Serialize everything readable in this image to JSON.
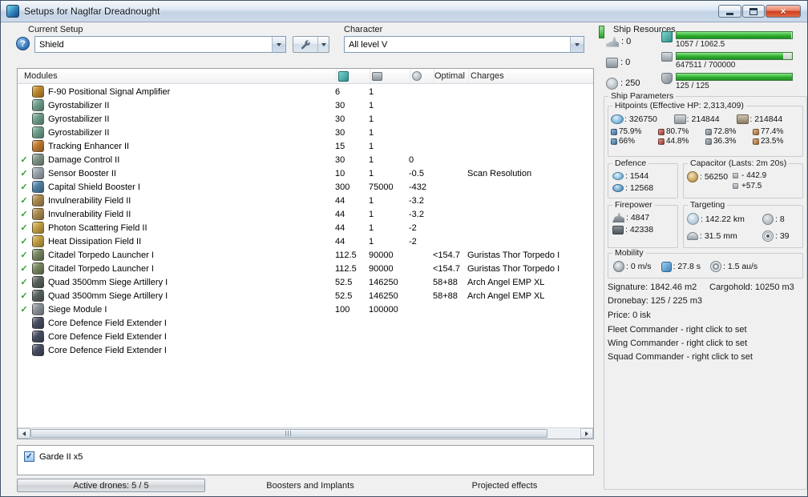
{
  "window": {
    "title": "Setups for Naglfar Dreadnought"
  },
  "icons": {
    "help": "?",
    "close": "×",
    "check": "✓"
  },
  "toolbar": {
    "current_setup_label": "Current Setup",
    "current_setup_value": "Shield",
    "character_label": "Character",
    "character_value": "All level V"
  },
  "modules_table": {
    "header_modules": "Modules",
    "header_optimal": "Optimal",
    "header_charges": "Charges",
    "rows": [
      {
        "check": "",
        "name": "F-90 Positional Signal Amplifier",
        "cpu": "6",
        "pg": "1",
        "cap": "",
        "optimal": "",
        "charges": "",
        "icon": "#c08a2e"
      },
      {
        "check": "",
        "name": "Gyrostabilizer II",
        "cpu": "30",
        "pg": "1",
        "cap": "",
        "optimal": "",
        "charges": "",
        "icon": "#6f9e8a"
      },
      {
        "check": "",
        "name": "Gyrostabilizer II",
        "cpu": "30",
        "pg": "1",
        "cap": "",
        "optimal": "",
        "charges": "",
        "icon": "#6f9e8a"
      },
      {
        "check": "",
        "name": "Gyrostabilizer II",
        "cpu": "30",
        "pg": "1",
        "cap": "",
        "optimal": "",
        "charges": "",
        "icon": "#6f9e8a"
      },
      {
        "check": "",
        "name": "Tracking Enhancer II",
        "cpu": "15",
        "pg": "1",
        "cap": "",
        "optimal": "",
        "charges": "",
        "icon": "#c07a2e"
      },
      {
        "check": "✓",
        "name": "Damage Control II",
        "cpu": "30",
        "pg": "1",
        "cap": "0",
        "optimal": "",
        "charges": "",
        "icon": "#7f9486"
      },
      {
        "check": "✓",
        "name": "Sensor Booster II",
        "cpu": "10",
        "pg": "1",
        "cap": "-0.5",
        "optimal": "",
        "charges": "Scan Resolution",
        "icon": "#9aa4ad"
      },
      {
        "check": "✓",
        "name": "Capital Shield Booster I",
        "cpu": "300",
        "pg": "75000",
        "cap": "-432",
        "optimal": "",
        "charges": "",
        "icon": "#4f81a6"
      },
      {
        "check": "✓",
        "name": "Invulnerability Field II",
        "cpu": "44",
        "pg": "1",
        "cap": "-3.2",
        "optimal": "",
        "charges": "",
        "icon": "#ab8a50"
      },
      {
        "check": "✓",
        "name": "Invulnerability Field II",
        "cpu": "44",
        "pg": "1",
        "cap": "-3.2",
        "optimal": "",
        "charges": "",
        "icon": "#ab8a50"
      },
      {
        "check": "✓",
        "name": "Photon Scattering Field II",
        "cpu": "44",
        "pg": "1",
        "cap": "-2",
        "optimal": "",
        "charges": "",
        "icon": "#c3a042"
      },
      {
        "check": "✓",
        "name": "Heat Dissipation Field II",
        "cpu": "44",
        "pg": "1",
        "cap": "-2",
        "optimal": "",
        "charges": "",
        "icon": "#c3a042"
      },
      {
        "check": "✓",
        "name": "Citadel Torpedo Launcher I",
        "cpu": "112.5",
        "pg": "90000",
        "cap": "",
        "optimal": "<154.7",
        "charges": "Guristas Thor Torpedo I",
        "icon": "#76855f"
      },
      {
        "check": "✓",
        "name": "Citadel Torpedo Launcher I",
        "cpu": "112.5",
        "pg": "90000",
        "cap": "",
        "optimal": "<154.7",
        "charges": "Guristas Thor Torpedo I",
        "icon": "#76855f"
      },
      {
        "check": "✓",
        "name": "Quad 3500mm Siege Artillery I",
        "cpu": "52.5",
        "pg": "146250",
        "cap": "",
        "optimal": "58+88",
        "charges": "Arch Angel EMP XL",
        "icon": "#59625c"
      },
      {
        "check": "✓",
        "name": "Quad 3500mm Siege Artillery I",
        "cpu": "52.5",
        "pg": "146250",
        "cap": "",
        "optimal": "58+88",
        "charges": "Arch Angel EMP XL",
        "icon": "#59625c"
      },
      {
        "check": "✓",
        "name": "Siege Module I",
        "cpu": "100",
        "pg": "100000",
        "cap": "",
        "optimal": "",
        "charges": "",
        "icon": "#8b9197"
      },
      {
        "check": "",
        "name": "Core Defence Field Extender I",
        "cpu": "",
        "pg": "",
        "cap": "",
        "optimal": "",
        "charges": "",
        "icon": "#474d60"
      },
      {
        "check": "",
        "name": "Core Defence Field Extender I",
        "cpu": "",
        "pg": "",
        "cap": "",
        "optimal": "",
        "charges": "",
        "icon": "#474d60"
      },
      {
        "check": "",
        "name": "Core Defence Field Extender I",
        "cpu": "",
        "pg": "",
        "cap": "",
        "optimal": "",
        "charges": "",
        "icon": "#474d60"
      }
    ]
  },
  "drones": {
    "label": "Garde II x5"
  },
  "bottom_tabs": {
    "active_drones": "Active drones: 5 / 5",
    "boosters": "Boosters and Implants",
    "projected": "Projected effects"
  },
  "ship_resources": {
    "title": "Ship Resources",
    "turrets": "0",
    "launchers": "0",
    "calibration": "250",
    "cpu": {
      "text": "1057 / 1062.5",
      "pct": "99.5%"
    },
    "powergrid": {
      "text": "647511 / 700000",
      "pct": "92.5%"
    },
    "dronebay": {
      "text": "125 / 125",
      "pct": "100%"
    }
  },
  "ship_parameters": {
    "title": "Ship Parameters",
    "hitpoints": {
      "title": "Hitpoints (Effective HP: 2,313,409)",
      "shield": "326750",
      "armor": "214844",
      "structure": "214844",
      "resists": [
        {
          "type": "em",
          "color": "#3f7fbf",
          "shield": "75.9%",
          "armor": "66%"
        },
        {
          "type": "thermal",
          "color": "#bf3a2b",
          "shield": "80.7%",
          "armor": "44.8%"
        },
        {
          "type": "kinetic",
          "color": "#8d9aa5",
          "shield": "72.8%",
          "armor": "36.3%"
        },
        {
          "type": "explosive",
          "color": "#c97a2b",
          "shield": "77.4%",
          "armor": "23.5%"
        }
      ]
    },
    "defence": {
      "title": "Defence",
      "recharge": "1544",
      "boost": "12568"
    },
    "capacitor": {
      "title": "Capacitor (Lasts: 2m 20s)",
      "capacity": "56250",
      "drain": "- 442.9",
      "recharge": "+57.5"
    },
    "firepower": {
      "title": "Firepower",
      "volley": "4847",
      "dps": "42338"
    },
    "targeting": {
      "title": "Targeting",
      "range": "142.22 km",
      "max_targets": "8",
      "scan_resolution": "31.5 mm",
      "sensor_strength": "39"
    },
    "mobility": {
      "title": "Mobility",
      "speed": "0 m/s",
      "align_time": "27.8 s",
      "warp_speed": "1.5 au/s"
    },
    "info": {
      "signature": "Signature: 1842.46 m2",
      "cargohold": "Cargohold: 10250 m3",
      "dronebay": "Dronebay: 125 / 225 m3",
      "price": "Price: 0 isk",
      "fleet_commander": "Fleet Commander - right click to set",
      "wing_commander": "Wing Commander - right click to set",
      "squad_commander": "Squad Commander - right click to set"
    }
  }
}
